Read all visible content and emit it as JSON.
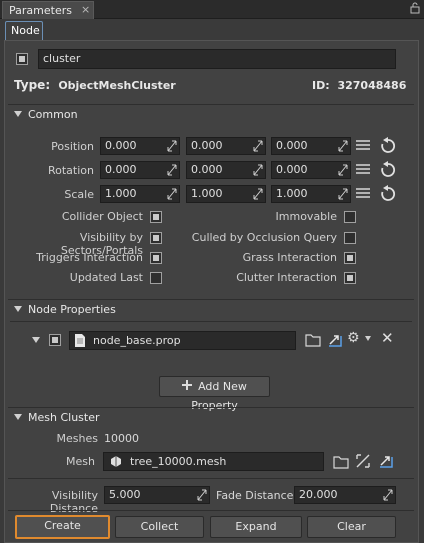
{
  "window": {
    "tab_title": "Parameters",
    "close": "×"
  },
  "subtab": "Node",
  "node": {
    "name": "cluster",
    "type_label": "Type:",
    "type_value": "ObjectMeshCluster",
    "id_label": "ID:",
    "id_value": "327048486"
  },
  "common": {
    "title": "Common",
    "rows": [
      {
        "label": "Position",
        "x": "0.000",
        "y": "0.000",
        "z": "0.000"
      },
      {
        "label": "Rotation",
        "x": "0.000",
        "y": "0.000",
        "z": "0.000"
      },
      {
        "label": "Scale",
        "x": "1.000",
        "y": "1.000",
        "z": "1.000"
      }
    ],
    "flags_left": [
      {
        "label": "Collider Object",
        "checked": true
      },
      {
        "label": "Visibility by Sectors/Portals",
        "checked": true
      },
      {
        "label": "Triggers Interaction",
        "checked": true
      },
      {
        "label": "Updated Last",
        "checked": false
      }
    ],
    "flags_right": [
      {
        "label": "Immovable",
        "checked": false
      },
      {
        "label": "Culled by Occlusion Query",
        "checked": false
      },
      {
        "label": "Grass Interaction",
        "checked": true
      },
      {
        "label": "Clutter Interaction",
        "checked": true
      }
    ]
  },
  "node_properties": {
    "title": "Node Properties",
    "file": "node_base.prop",
    "add_label": "Add New Property"
  },
  "mesh_cluster": {
    "title": "Mesh Cluster",
    "meshes_label": "Meshes",
    "meshes_value": "10000",
    "mesh_label": "Mesh",
    "mesh_file": "tree_10000.mesh",
    "vis_label": "Visibility Distance",
    "vis_value": "5.000",
    "fade_label": "Fade Distance",
    "fade_value": "20.000"
  },
  "actions": {
    "create": "Create",
    "collect": "Collect",
    "expand": "Expand",
    "clear": "Clear"
  }
}
